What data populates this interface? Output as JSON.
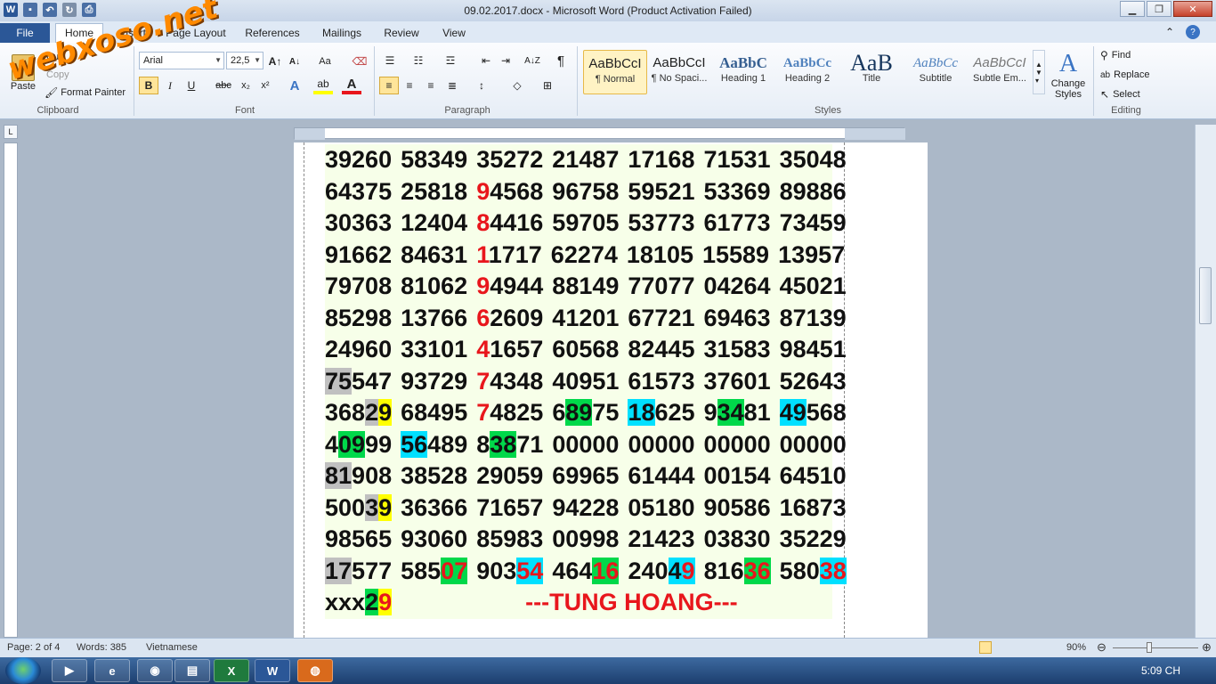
{
  "window": {
    "title": "09.02.2017.docx - Microsoft Word (Product Activation Failed)",
    "minimize": "▁",
    "maximize": "❐",
    "close": "✕"
  },
  "watermark": "webxoso.net",
  "tabs": [
    "File",
    "Home",
    "Insert",
    "Page Layout",
    "References",
    "Mailings",
    "Review",
    "View"
  ],
  "ribbon": {
    "clipboard": {
      "paste": "Paste",
      "cut": "Cut",
      "copy": "Copy",
      "format_painter": "Format Painter",
      "label": "Clipboard"
    },
    "font": {
      "name": "Arial",
      "size": "22,5",
      "label": "Font"
    },
    "paragraph": {
      "label": "Paragraph"
    },
    "styles": {
      "items": [
        {
          "sample": "AaBbCcI",
          "label": "¶ Normal"
        },
        {
          "sample": "AaBbCcI",
          "label": "¶ No Spaci..."
        },
        {
          "sample": "AaBbC",
          "label": "Heading 1"
        },
        {
          "sample": "AaBbCc",
          "label": "Heading 2"
        },
        {
          "sample": "AaB",
          "label": "Title"
        },
        {
          "sample": "AaBbCc",
          "label": "Subtitle"
        },
        {
          "sample": "AaBbCcI",
          "label": "Subtle Em..."
        }
      ],
      "change": "Change Styles",
      "label": "Styles"
    },
    "editing": {
      "find": "Find",
      "replace": "Replace",
      "select": "Select",
      "label": "Editing"
    }
  },
  "document": {
    "lines": [
      "39260 58349 35272 21487 17168 71531 35048",
      "64375 25818 94568 96758 59521 53369 89886",
      "30363 12404 84416 59705 53773 61773 73459",
      "91662 84631 11717 62274 18105 15589 13957",
      "79708 81062 94944 88149 77077 04264 45021",
      "85298 13766 62609 41201 67721 69463 87139",
      "24960 33101 41657 60568 82445 31583 98451",
      "75547 93729 74348 40951 61573 37601 52643",
      "36829 68495 74825 68975 18625 93481 49568",
      "40999 56489 83871 00000 00000 00000 00000",
      "81908 38528 29059 69965 61444 00154 64510",
      "50039 36366 71657 94228 05180 90586 16873",
      "98565 93060 85983 00998 21423 03830 35229",
      "17577 58507 90354 46416 24049 81636 58038",
      "xxx29"
    ],
    "signature": "---TUNG HOANG---"
  },
  "statusbar": {
    "page": "Page: 2 of 4",
    "words": "Words: 385",
    "language": "Vietnamese",
    "zoom": "90%"
  },
  "taskbar": {
    "clock": "5:09 CH"
  }
}
